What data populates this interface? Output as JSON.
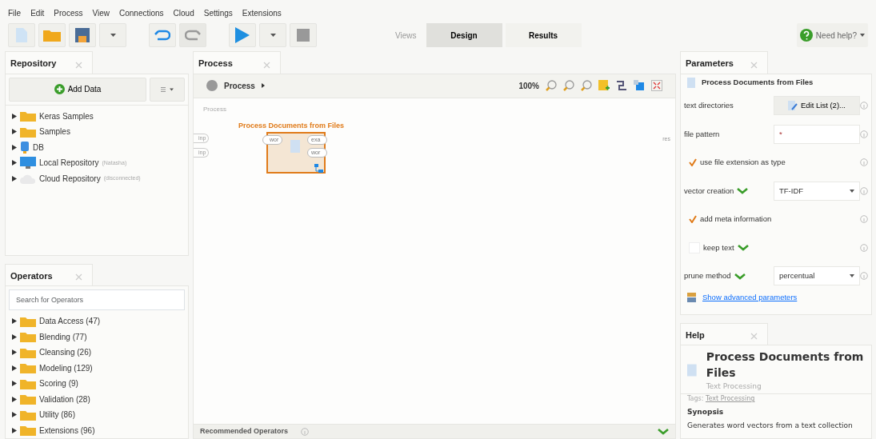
{
  "menu": [
    "File",
    "Edit",
    "Process",
    "View",
    "Connections",
    "Cloud",
    "Settings",
    "Extensions"
  ],
  "views": {
    "label": "Views",
    "tabs": [
      {
        "label": "Design",
        "selected": true
      },
      {
        "label": "Results",
        "selected": false
      }
    ]
  },
  "help_button": "Need help?",
  "repository": {
    "title": "Repository",
    "add_button": "Add Data",
    "items": [
      {
        "kind": "folder",
        "label": "Keras Samples"
      },
      {
        "kind": "folder",
        "label": "Samples"
      },
      {
        "kind": "db",
        "label": "DB"
      },
      {
        "kind": "local",
        "label": "Local Repository",
        "note": "(Natasha)"
      },
      {
        "kind": "cloud",
        "label": "Cloud Repository",
        "note": "(disconnected)"
      }
    ]
  },
  "operators": {
    "title": "Operators",
    "placeholder": "Search for Operators",
    "items": [
      {
        "label": "Data Access (47)"
      },
      {
        "label": "Blending (77)"
      },
      {
        "label": "Cleansing (26)"
      },
      {
        "label": "Modeling (129)"
      },
      {
        "label": "Scoring (9)"
      },
      {
        "label": "Validation (28)"
      },
      {
        "label": "Utility (86)"
      },
      {
        "label": "Extensions (96)"
      }
    ]
  },
  "process": {
    "title": "Process",
    "breadcrumb": "Process",
    "zoom": "100%",
    "canvas_label": "Process",
    "inputs": [
      "inp",
      "inp"
    ],
    "outputs": [
      "res"
    ],
    "operator": {
      "name": "Process Documents from Files",
      "in_ports": [
        "wor"
      ],
      "out_ports": [
        "exa",
        "wor"
      ],
      "selected": true
    },
    "recommended": "Recommended Operators"
  },
  "parameters": {
    "title": "Parameters",
    "operator": "Process Documents from Files",
    "rows": [
      {
        "kind": "button",
        "label": "text directories",
        "value": "Edit List (2)..."
      },
      {
        "kind": "text",
        "label": "file pattern",
        "value": "*"
      },
      {
        "kind": "checkbox",
        "label": "use file extension as type",
        "checked": true
      },
      {
        "kind": "select",
        "label": "vector creation",
        "value": "TF-IDF",
        "flagged": true
      },
      {
        "kind": "checkbox",
        "label": "add meta information",
        "checked": true
      },
      {
        "kind": "checkbox",
        "label": "keep text",
        "checked": false,
        "flagged": true
      },
      {
        "kind": "select",
        "label": "prune method",
        "value": "percentual",
        "flagged": true
      }
    ],
    "advanced_link": "Show advanced parameters"
  },
  "help": {
    "title": "Help",
    "heading": "Process Documents from Files",
    "subtitle": "Text Processing",
    "tags_label": "Tags:",
    "tag": "Text Processing",
    "section": "Synopsis",
    "text": "Generates word vectors from a text collection"
  }
}
